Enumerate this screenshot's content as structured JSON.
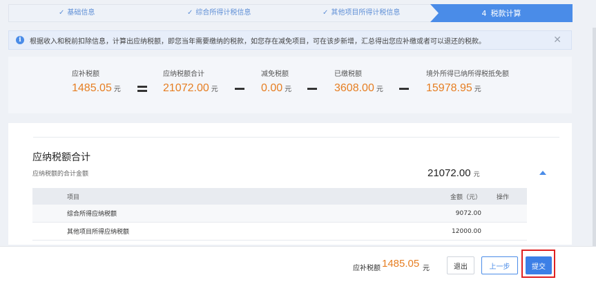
{
  "steps": [
    {
      "label": "基础信息",
      "check": "✓"
    },
    {
      "label": "综合所得计税信息",
      "check": "✓"
    },
    {
      "label": "其他项目所得计税信息",
      "check": "✓"
    }
  ],
  "active_step": {
    "number": "4",
    "label": "税款计算"
  },
  "notice": {
    "text": "根据收入和税前扣除信息，计算出应纳税额，即您当年需要缴纳的税款，如您存在减免项目，可在该步新增，汇总得出您应补缴或者可以退还的税款。",
    "icon": "info-icon",
    "close": "✕"
  },
  "summary": {
    "items": [
      {
        "label": "应补税额",
        "value": "1485.05",
        "unit": "元"
      },
      {
        "label": "应纳税额合计",
        "value": "21072.00",
        "unit": "元"
      },
      {
        "label": "减免税额",
        "value": "0.00",
        "unit": "元"
      },
      {
        "label": "已缴税额",
        "value": "3608.00",
        "unit": "元"
      },
      {
        "label": "境外所得已纳所得税抵免额",
        "value": "15978.95",
        "unit": "元"
      }
    ]
  },
  "details": {
    "title": "应纳税额合计",
    "subtitle": "应纳税额的合计金额",
    "total": "21072.00",
    "total_unit": "元",
    "table": {
      "headers": {
        "name": "项目",
        "amount": "金额（元）",
        "op": "操作"
      },
      "rows": [
        {
          "name": "综合所得应纳税额",
          "amount": "9072.00"
        },
        {
          "name": "其他项目所得应纳税额",
          "amount": "12000.00"
        }
      ]
    }
  },
  "footer": {
    "label": "应补税额",
    "amount": "1485.05",
    "unit": "元",
    "exit": "退出",
    "prev": "上一步",
    "submit": "提交"
  },
  "colors": {
    "accent": "#4a8ce8",
    "amount": "#e67e22",
    "highlight": "#e02020"
  }
}
